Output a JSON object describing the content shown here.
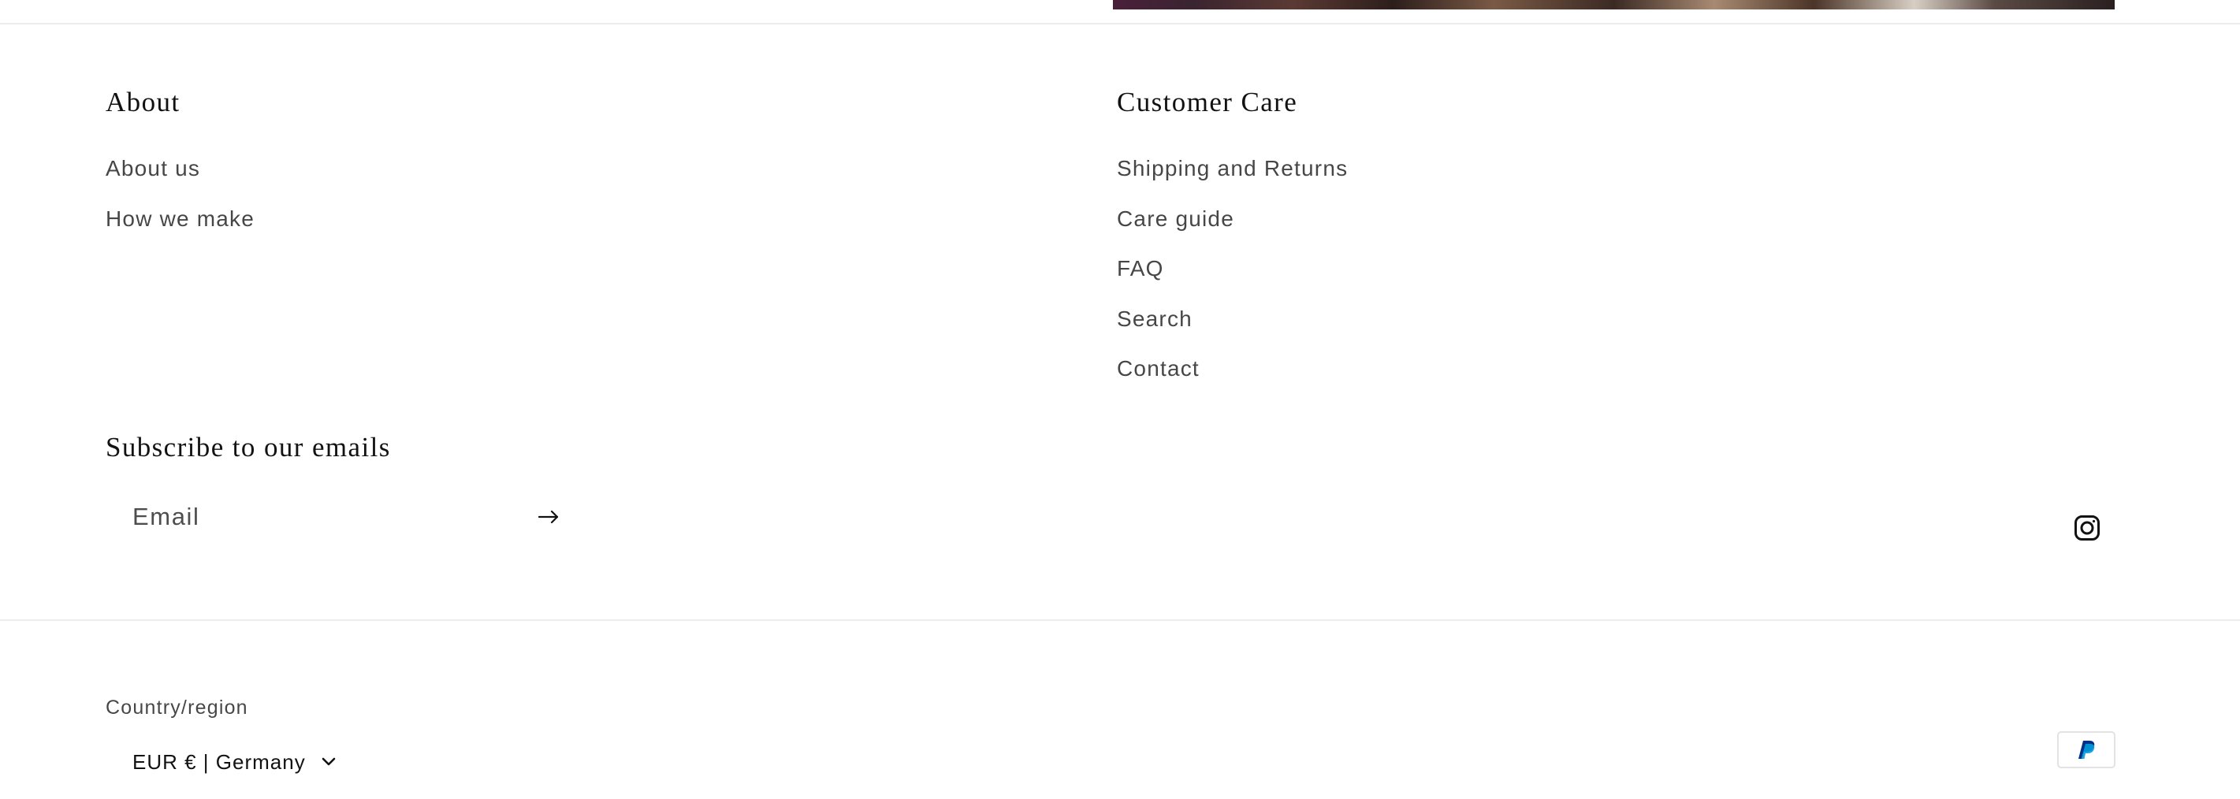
{
  "about": {
    "heading": "About",
    "links": [
      {
        "label": "About us"
      },
      {
        "label": "How we make"
      }
    ]
  },
  "customer_care": {
    "heading": "Customer Care",
    "links": [
      {
        "label": "Shipping and Returns"
      },
      {
        "label": "Care guide"
      },
      {
        "label": "FAQ"
      },
      {
        "label": "Search"
      },
      {
        "label": "Contact"
      }
    ]
  },
  "newsletter": {
    "heading": "Subscribe to our emails",
    "email_placeholder": "Email",
    "submit_icon": "arrow-right-icon"
  },
  "social": {
    "icon": "instagram-icon"
  },
  "localization": {
    "label": "Country/region",
    "selected": "EUR € | Germany",
    "chevron_icon": "chevron-down-icon"
  },
  "payment": {
    "icon": "paypal-icon"
  },
  "colors": {
    "text": "#121212",
    "divider": "#ececec",
    "paypal_dark": "#003087",
    "paypal_light": "#009cde"
  }
}
